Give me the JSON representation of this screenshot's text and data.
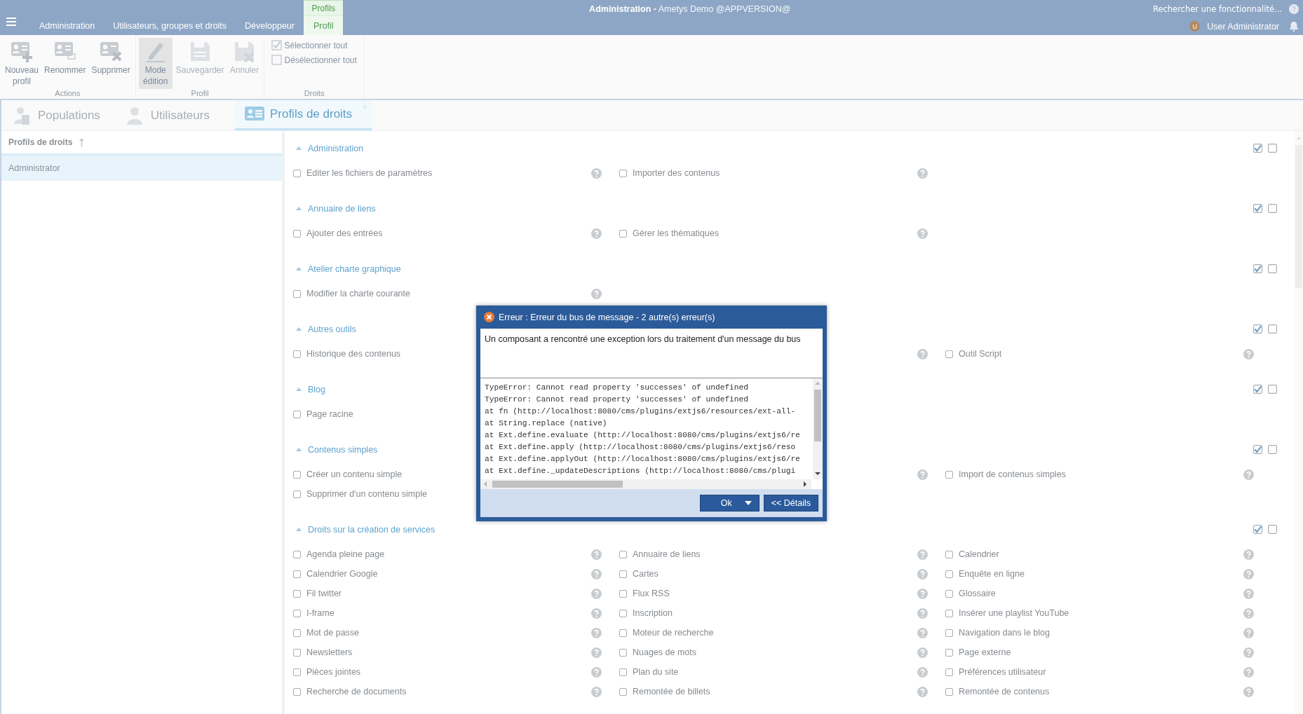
{
  "title": "**Administration -** Ametys Demo @APPVERSION@",
  "ribbon_tabs": [
    {
      "label": "Administration",
      "selected": false
    },
    {
      "label": "Utilisateurs, groupes et droits",
      "selected": false
    },
    {
      "label": "Développeur",
      "selected": false
    },
    {
      "label": "Profil",
      "selected": true,
      "context": "Profils"
    }
  ],
  "search": {
    "placeholder": "Rechercher une fonctionnalité..."
  },
  "user": {
    "initial": "U",
    "name": "User Administrator"
  },
  "ribbon_groups": [
    {
      "label": "Actions",
      "buttons": [
        {
          "label": "Nouveau profil",
          "selected": false,
          "disabled": false
        },
        {
          "label": "Renommer",
          "selected": false,
          "disabled": false
        },
        {
          "label": "Supprimer",
          "selected": false,
          "disabled": false
        }
      ]
    },
    {
      "label": "Profil",
      "buttons": [
        {
          "label": "Mode édition",
          "selected": true,
          "disabled": false
        },
        {
          "label": "Sauvegarder",
          "selected": false,
          "disabled": true
        },
        {
          "label": "Annuler",
          "selected": false,
          "disabled": true
        }
      ]
    },
    {
      "label": "Droits",
      "checks": [
        {
          "label": "Sélectionner tout",
          "kind": "check"
        },
        {
          "label": "Désélectionner tout",
          "kind": "uncheck"
        }
      ]
    }
  ],
  "doc_tabs": [
    {
      "label": "Populations",
      "selected": false,
      "closable": false
    },
    {
      "label": "Utilisateurs",
      "selected": false,
      "closable": false
    },
    {
      "label": "Profils de droits",
      "selected": true,
      "closable": true
    }
  ],
  "profiles": {
    "column": "Profils de droits",
    "rows": [
      {
        "label": "Administrator",
        "selected": true
      }
    ]
  },
  "rights": [
    {
      "title": "Administration",
      "expanded": true,
      "allow": true,
      "deny": false,
      "rows": [
        [
          {
            "label": "Editer les fichiers de paramètres",
            "checked": false,
            "help": true
          },
          {
            "label": "Importer des contenus",
            "checked": false,
            "help": true
          },
          null
        ]
      ]
    },
    {
      "title": "Annuaire de liens",
      "expanded": true,
      "allow": true,
      "deny": false,
      "rows": [
        [
          {
            "label": "Ajouter des entrées",
            "checked": false,
            "help": true
          },
          {
            "label": "Gérer les thématiques",
            "checked": false,
            "help": true
          },
          null
        ]
      ]
    },
    {
      "title": "Atelier charte graphique",
      "expanded": true,
      "allow": true,
      "deny": false,
      "rows": [
        [
          {
            "label": "Modifier la charte courante",
            "checked": false,
            "help": true
          },
          null,
          null
        ]
      ]
    },
    {
      "title": "Autres outils",
      "expanded": true,
      "allow": true,
      "deny": false,
      "rows": [
        [
          {
            "label": "Historique des contenus",
            "checked": false,
            "help": false
          },
          {
            "help": true
          },
          {
            "label": "Outil Script",
            "checked": false,
            "help": true
          }
        ]
      ]
    },
    {
      "title": "Blog",
      "expanded": true,
      "allow": true,
      "deny": false,
      "rows": [
        [
          {
            "label": "Page racine",
            "checked": false,
            "help": false
          },
          null,
          null
        ]
      ]
    },
    {
      "title": "Contenus simples",
      "expanded": true,
      "allow": true,
      "deny": false,
      "rows": [
        [
          {
            "label": "Créer un contenu simple",
            "checked": false,
            "help": false
          },
          {
            "help": true
          },
          {
            "label": "Import de contenus simples",
            "checked": false,
            "help": true
          }
        ],
        [
          {
            "label": "Supprimer d'un contenu simple",
            "checked": false,
            "help": false
          },
          null,
          null
        ]
      ]
    },
    {
      "title": "Droits sur la création de services",
      "expanded": true,
      "allow": true,
      "deny": false,
      "rows": [
        [
          {
            "label": "Agenda pleine page",
            "checked": false,
            "help": true
          },
          {
            "label": "Annuaire de liens",
            "checked": false,
            "help": true
          },
          {
            "label": "Calendrier",
            "checked": false,
            "help": true
          }
        ],
        [
          {
            "label": "Calendrier Google",
            "checked": false,
            "help": true
          },
          {
            "label": "Cartes",
            "checked": false,
            "help": true
          },
          {
            "label": "Enquête en ligne",
            "checked": false,
            "help": true
          }
        ],
        [
          {
            "label": "Fil twitter",
            "checked": false,
            "help": true
          },
          {
            "label": "Flux RSS",
            "checked": false,
            "help": true
          },
          {
            "label": "Glossaire",
            "checked": false,
            "help": true
          }
        ],
        [
          {
            "label": "I-frame",
            "checked": false,
            "help": true
          },
          {
            "label": "Inscription",
            "checked": false,
            "help": true
          },
          {
            "label": "Insérer une playlist YouTube",
            "checked": false,
            "help": true
          }
        ],
        [
          {
            "label": "Mot de passe",
            "checked": false,
            "help": true
          },
          {
            "label": "Moteur de recherche",
            "checked": false,
            "help": true
          },
          {
            "label": "Navigation dans le blog",
            "checked": false,
            "help": true
          }
        ],
        [
          {
            "label": "Newsletters",
            "checked": false,
            "help": true
          },
          {
            "label": "Nuages de mots",
            "checked": false,
            "help": true
          },
          {
            "label": "Page externe",
            "checked": false,
            "help": true
          }
        ],
        [
          {
            "label": "Pièces jointes",
            "checked": false,
            "help": true
          },
          {
            "label": "Plan du site",
            "checked": false,
            "help": true
          },
          {
            "label": "Préférences utilisateur",
            "checked": false,
            "help": true
          }
        ],
        [
          {
            "label": "Recherche de documents",
            "checked": false,
            "help": true
          },
          {
            "label": "Remontée de billets",
            "checked": false,
            "help": true
          },
          {
            "label": "Remontée de contenus",
            "checked": false,
            "help": true
          }
        ]
      ]
    }
  ],
  "dialog": {
    "title": "Erreur : Erreur du bus de message - 2 autre(s) erreur(s)",
    "message": "Un composant a rencontré une exception lors du traitement d'un message du bus",
    "details": [
      "TypeError: Cannot read property 'successes' of undefined",
      "TypeError: Cannot read property 'successes' of undefined",
      "at fn (http://localhost:8080/cms/plugins/extjs6/resources/ext-all-",
      "at String.replace (native)",
      "at Ext.define.evaluate (http://localhost:8080/cms/plugins/extjs6/re",
      "at Ext.define.apply (http://localhost:8080/cms/plugins/extjs6/reso",
      "at Ext.define.applyOut (http://localhost:8080/cms/plugins/extjs6/re",
      "at Ext.define._updateDescriptions (http://localhost:8080/cms/plugi"
    ],
    "buttons": [
      {
        "label": "Ok",
        "kind": "split"
      },
      {
        "label": "<< Détails",
        "kind": "plain"
      }
    ]
  }
}
